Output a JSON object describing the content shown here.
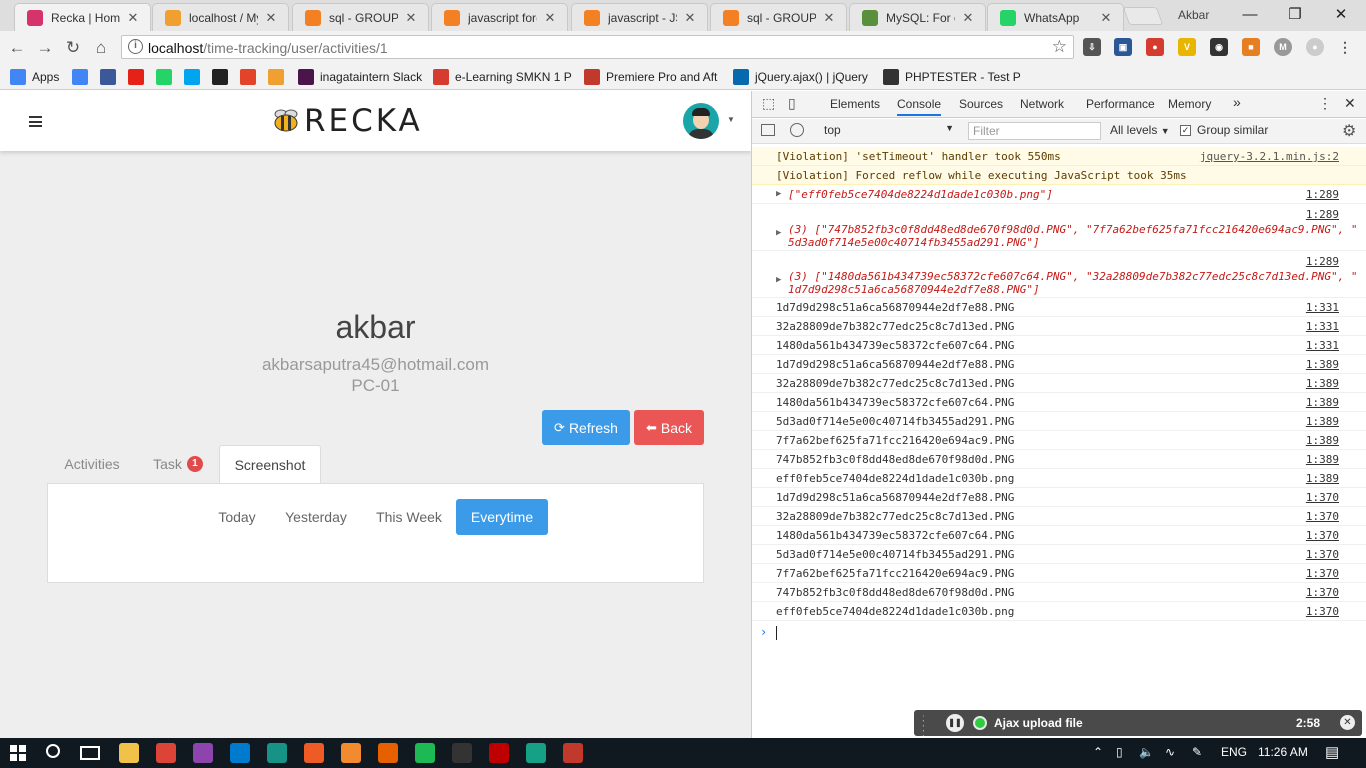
{
  "browser": {
    "tabs": [
      {
        "label": "Recka | Home",
        "icon": "recka-favicon",
        "color": "#d6336c",
        "active": true
      },
      {
        "label": "localhost / My",
        "icon": "phpmyadmin-favicon",
        "color": "#f0a030",
        "active": false
      },
      {
        "label": "sql - GROUP B",
        "icon": "stackoverflow-favicon",
        "color": "#f48024",
        "active": false
      },
      {
        "label": "javascript for()",
        "icon": "stackoverflow-favicon",
        "color": "#f48024",
        "active": false
      },
      {
        "label": "javascript - JS",
        "icon": "stackoverflow-favicon",
        "color": "#f48024",
        "active": false
      },
      {
        "label": "sql - GROUP B",
        "icon": "stackoverflow-favicon",
        "color": "#f48024",
        "active": false
      },
      {
        "label": "MySQL: For ea",
        "icon": "mysql-favicon",
        "color": "#5a8f3c",
        "active": false
      },
      {
        "label": "WhatsApp",
        "icon": "whatsapp-favicon",
        "color": "#25d366",
        "active": false
      }
    ],
    "user": "Akbar",
    "url_host": "localhost",
    "url_path": "/time-tracking/user/activities/1",
    "bookmarks": [
      {
        "label": "Apps",
        "icon": "apps-grid-icon",
        "color": "#4285f4"
      },
      {
        "label": "",
        "icon": "google-icon",
        "color": "#4285f4"
      },
      {
        "label": "",
        "icon": "facebook-icon",
        "color": "#3b5998"
      },
      {
        "label": "",
        "icon": "youtube-icon",
        "color": "#e62117"
      },
      {
        "label": "",
        "icon": "whatsapp-icon",
        "color": "#25d366"
      },
      {
        "label": "",
        "icon": "microsoft-icon",
        "color": "#00a4ef"
      },
      {
        "label": "",
        "icon": "github-icon",
        "color": "#222222"
      },
      {
        "label": "",
        "icon": "gitlab-icon",
        "color": "#e24329"
      },
      {
        "label": "",
        "icon": "phpmyadmin-icon",
        "color": "#f0a030"
      },
      {
        "label": "inagataintern Slack",
        "icon": "slack-icon",
        "color": "#4a154b"
      },
      {
        "label": "e-Learning SMKN 1 P",
        "icon": "elearning-icon",
        "color": "#d63b2f"
      },
      {
        "label": "Premiere Pro and Aft",
        "icon": "premiere-icon",
        "color": "#c0392b"
      },
      {
        "label": "jQuery.ajax() | jQuery",
        "icon": "jquery-icon",
        "color": "#0769ad"
      },
      {
        "label": "PHPTESTER - Test PH",
        "icon": "phptester-icon",
        "color": "#333333"
      }
    ]
  },
  "app": {
    "logo_text": "RECKA",
    "user_name": "akbar",
    "user_email": "akbarsaputra45@hotmail.com",
    "user_pc": "PC-01",
    "refresh_label": "Refresh",
    "back_label": "Back",
    "tabs": [
      {
        "label": "Activities",
        "badge": ""
      },
      {
        "label": "Task",
        "badge": "1"
      },
      {
        "label": "Screenshot",
        "badge": ""
      }
    ],
    "filters": [
      "Today",
      "Yesterday",
      "This Week",
      "Everytime"
    ],
    "active_filter": "Everytime",
    "accent": "#3c9be8",
    "danger": "#ea5555"
  },
  "devtools": {
    "tabs": [
      "Elements",
      "Console",
      "Sources",
      "Network",
      "Performance",
      "Memory"
    ],
    "more": "»",
    "context": "top",
    "filter_placeholder": "Filter",
    "levels": "All levels",
    "group_similar": "Group similar",
    "warnings": [
      {
        "text": "[Violation] 'setTimeout' handler took 550ms",
        "src": "jquery-3.2.1.min.js:2"
      },
      {
        "text": "[Violation] Forced reflow while executing JavaScript took 35ms",
        "src": ""
      }
    ],
    "arrays": [
      {
        "line1": "[\"eff0feb5ce7404de8224d1dade1c030b.png\"]",
        "line2": "",
        "src": "1:289"
      },
      {
        "line1": "(3) [\"747b852fb3c0f8dd48ed8de670f98d0d.PNG\", \"7f7a62bef625fa71fcc216420e694ac9.PNG\", \"",
        "line2": "5d3ad0f714e5e00c40714fb3455ad291.PNG\"]",
        "src": "1:289"
      },
      {
        "line1": "(3) [\"1480da561b434739ec58372cfe607c64.PNG\", \"32a28809de7b382c77edc25c8c7d13ed.PNG\", \"",
        "line2": "1d7d9d298c51a6ca56870944e2df7e88.PNG\"]",
        "src": "1:289"
      }
    ],
    "logs": [
      {
        "text": "1d7d9d298c51a6ca56870944e2df7e88.PNG",
        "src": "1:331"
      },
      {
        "text": "32a28809de7b382c77edc25c8c7d13ed.PNG",
        "src": "1:331"
      },
      {
        "text": "1480da561b434739ec58372cfe607c64.PNG",
        "src": "1:331"
      },
      {
        "text": "1d7d9d298c51a6ca56870944e2df7e88.PNG",
        "src": "1:389"
      },
      {
        "text": "32a28809de7b382c77edc25c8c7d13ed.PNG",
        "src": "1:389"
      },
      {
        "text": "1480da561b434739ec58372cfe607c64.PNG",
        "src": "1:389"
      },
      {
        "text": "5d3ad0f714e5e00c40714fb3455ad291.PNG",
        "src": "1:389"
      },
      {
        "text": "7f7a62bef625fa71fcc216420e694ac9.PNG",
        "src": "1:389"
      },
      {
        "text": "747b852fb3c0f8dd48ed8de670f98d0d.PNG",
        "src": "1:389"
      },
      {
        "text": "eff0feb5ce7404de8224d1dade1c030b.png",
        "src": "1:389"
      },
      {
        "text": "1d7d9d298c51a6ca56870944e2df7e88.PNG",
        "src": "1:370"
      },
      {
        "text": "32a28809de7b382c77edc25c8c7d13ed.PNG",
        "src": "1:370"
      },
      {
        "text": "1480da561b434739ec58372cfe607c64.PNG",
        "src": "1:370"
      },
      {
        "text": "5d3ad0f714e5e00c40714fb3455ad291.PNG",
        "src": "1:370"
      },
      {
        "text": "7f7a62bef625fa71fcc216420e694ac9.PNG",
        "src": "1:370"
      },
      {
        "text": "747b852fb3c0f8dd48ed8de670f98d0d.PNG",
        "src": "1:370"
      },
      {
        "text": "eff0feb5ce7404de8224d1dade1c030b.png",
        "src": "1:370"
      }
    ]
  },
  "notification": {
    "title": "Ajax upload file",
    "time": "2:58"
  },
  "taskbar": {
    "apps": [
      {
        "icon": "file-explorer-icon",
        "color": "#f0c24a"
      },
      {
        "icon": "chrome-icon",
        "color": "#db4437"
      },
      {
        "icon": "app-pink-icon",
        "color": "#8e44ad"
      },
      {
        "icon": "vscode-icon",
        "color": "#007acc"
      },
      {
        "icon": "gitkraken-icon",
        "color": "#179287"
      },
      {
        "icon": "postman-icon",
        "color": "#ef5b25"
      },
      {
        "icon": "sublime-icon",
        "color": "#f28b30"
      },
      {
        "icon": "firefox-icon",
        "color": "#e66000"
      },
      {
        "icon": "spotify-icon",
        "color": "#1db954"
      },
      {
        "icon": "terminal-icon",
        "color": "#333333"
      },
      {
        "icon": "filezilla-icon",
        "color": "#bf0000"
      },
      {
        "icon": "app-green-icon",
        "color": "#16a085"
      },
      {
        "icon": "app-red-icon",
        "color": "#c0392b"
      }
    ],
    "lang": "ENG",
    "time": "11:26 AM"
  }
}
